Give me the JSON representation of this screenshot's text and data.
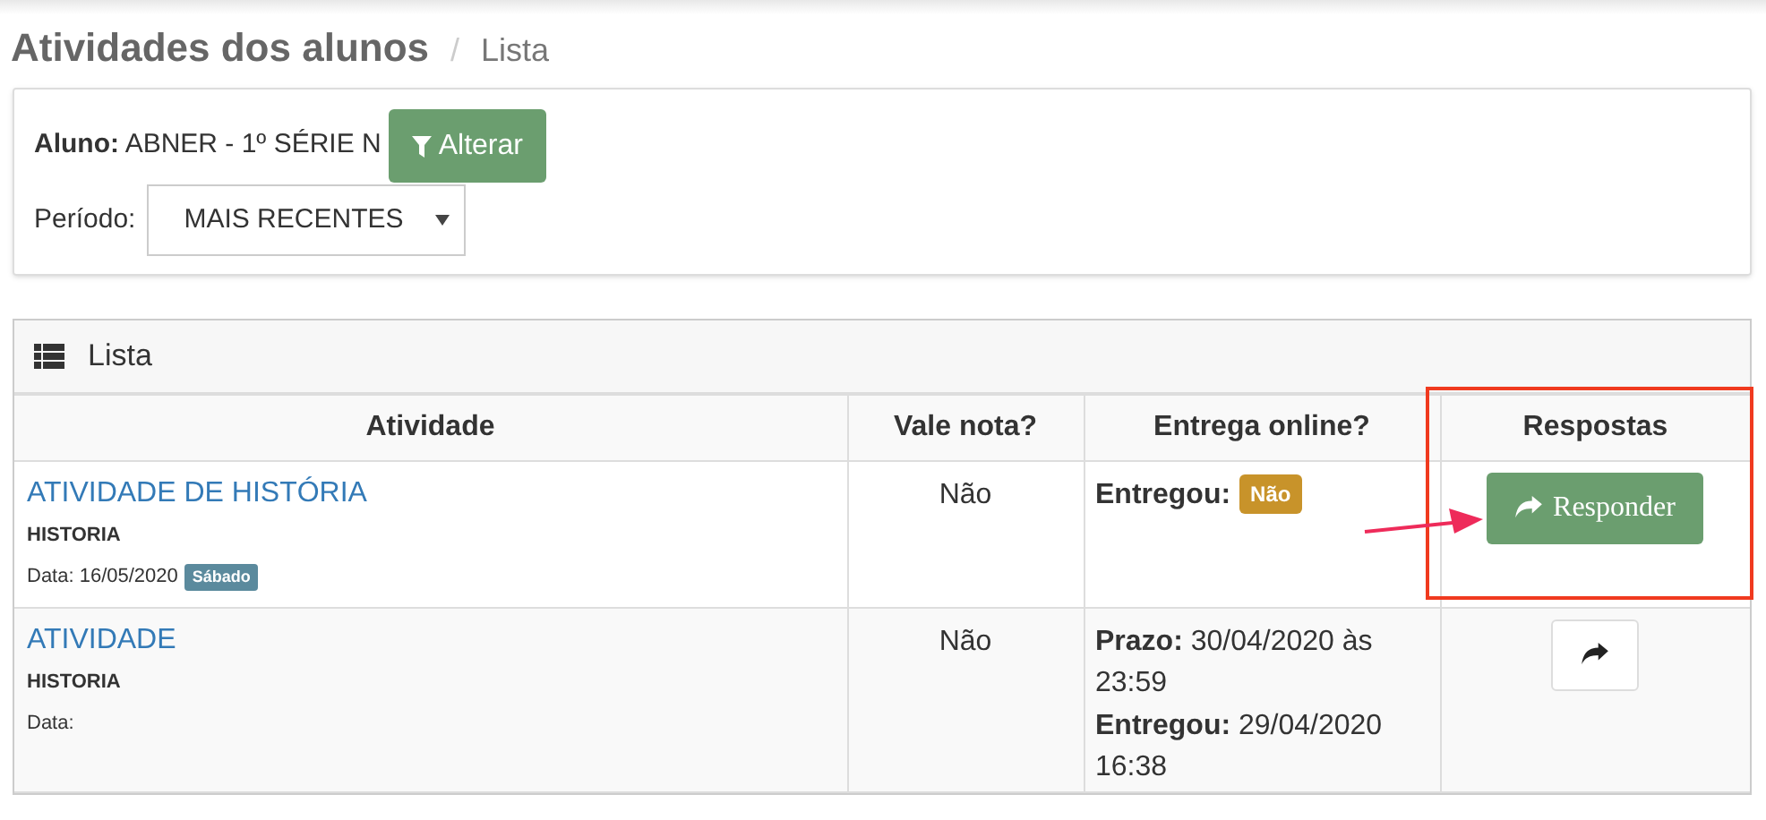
{
  "header": {
    "title": "Atividades dos alunos",
    "separator": "/",
    "subtitle": "Lista"
  },
  "filters": {
    "student_label": "Aluno:",
    "student": "ABNER - 1º SÉRIE N",
    "change_button": "Alterar",
    "period_label": "Período:",
    "period_value": "MAIS RECENTES"
  },
  "panel": {
    "title": "Lista"
  },
  "table": {
    "columns": [
      "Atividade",
      "Vale nota?",
      "Entrega online?",
      "Respostas"
    ],
    "rows": [
      {
        "title": "ATIVIDADE DE HISTÓRIA",
        "subject": "HISTORIA",
        "date": "Data: 16/05/2020",
        "weekday_badge": "Sábado",
        "graded": "Não",
        "delivery": [
          {
            "text": "**Entregou:**",
            "badge": "Não"
          }
        ],
        "answer": {
          "kind": "text",
          "label": "Responder"
        },
        "highlighted": true
      },
      {
        "title": "ATIVIDADE",
        "subject": "HISTORIA",
        "date": "Data:",
        "graded": "Não",
        "delivery": [
          {
            "text": "**Prazo:** 30/04/2020 às 23:59"
          },
          {
            "text": "**Entregou:** 29/04/2020 16:38"
          }
        ],
        "answer": {
          "kind": "icon"
        },
        "highlighted": false
      }
    ]
  }
}
